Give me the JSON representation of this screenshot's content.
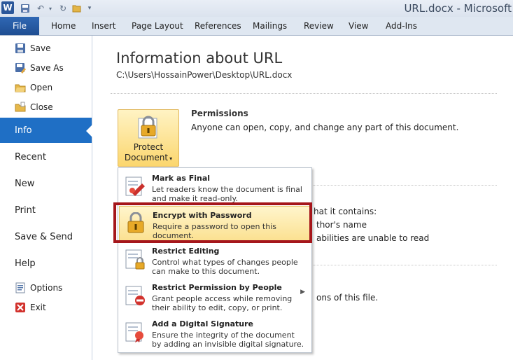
{
  "titlebar": {
    "title": "URL.docx - Microsoft",
    "app_logo": "W"
  },
  "ribbon": {
    "file_tab": "File",
    "tabs": [
      "Home",
      "Insert",
      "Page Layout",
      "References",
      "Mailings",
      "Review",
      "View",
      "Add-Ins"
    ]
  },
  "nav": {
    "save": "Save",
    "save_as": "Save As",
    "open": "Open",
    "close": "Close",
    "info": "Info",
    "recent": "Recent",
    "new": "New",
    "print": "Print",
    "save_send": "Save & Send",
    "help": "Help",
    "options": "Options",
    "exit": "Exit"
  },
  "info": {
    "title": "Information about URL",
    "path": "C:\\Users\\HossainPower\\Desktop\\URL.docx",
    "protect_label_1": "Protect",
    "protect_label_2": "Document",
    "permissions_heading": "Permissions",
    "permissions_desc": "Anyone can open, copy, and change any part of this document.",
    "bg_line1": "hat it contains:",
    "bg_line2": "thor's name",
    "bg_line3": "abilities are unable to read",
    "bg_line4": "ons of this file."
  },
  "menu": {
    "items": [
      {
        "title": "Mark as Final",
        "desc1": "Let readers know the document is final",
        "desc2": "and make it read-only."
      },
      {
        "title": "Encrypt with Password",
        "desc1": "Require a password to open this",
        "desc2": "document."
      },
      {
        "title": "Restrict Editing",
        "desc1": "Control what types of changes people",
        "desc2": "can make to this document."
      },
      {
        "title": "Restrict Permission by People",
        "desc1": "Grant people access while removing",
        "desc2": "their ability to edit, copy, or print."
      },
      {
        "title": "Add a Digital Signature",
        "desc1": "Ensure the integrity of the document",
        "desc2": "by adding an invisible digital signature."
      }
    ]
  },
  "colors": {
    "accent": "#1f6fc5",
    "highlight": "#a5161b",
    "file_tab": "#2a5ea7"
  }
}
